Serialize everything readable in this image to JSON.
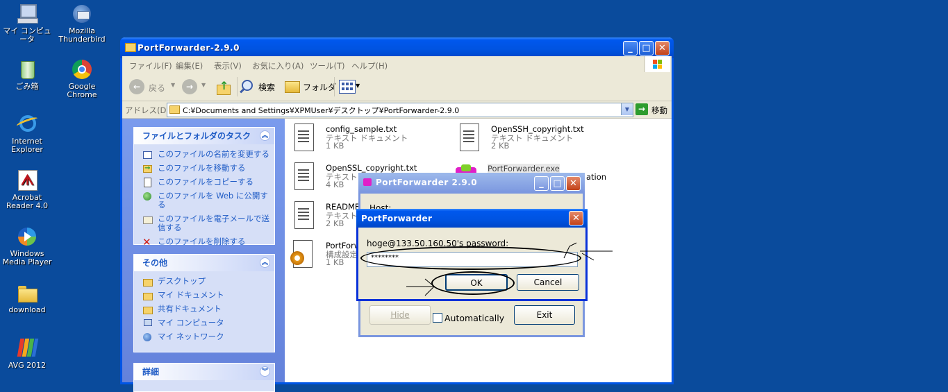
{
  "desktop": {
    "icons": [
      {
        "label": "マイ コンピュータ",
        "icon": "my-computer-icon"
      },
      {
        "label": "Mozilla Thunderbird",
        "icon": "thunderbird-icon"
      },
      {
        "label": "ごみ箱",
        "icon": "recycle-bin-icon"
      },
      {
        "label": "Google Chrome",
        "icon": "chrome-icon"
      },
      {
        "label": "Internet Explorer",
        "icon": "ie-icon"
      },
      {
        "label": "Acrobat Reader 4.0",
        "icon": "acrobat-icon"
      },
      {
        "label": "Windows Media Player",
        "icon": "wmp-icon"
      },
      {
        "label": "download",
        "icon": "folder-icon"
      },
      {
        "label": "AVG 2012",
        "icon": "avg-icon"
      }
    ]
  },
  "explorer": {
    "title": "PortForwarder-2.9.0",
    "menu": [
      "ファイル(F)",
      "編集(E)",
      "表示(V)",
      "お気に入り(A)",
      "ツール(T)",
      "ヘルプ(H)"
    ],
    "toolbar": {
      "back": "戻る",
      "search": "検索",
      "folders": "フォルダ"
    },
    "address": {
      "label": "アドレス(D)",
      "value": "C:¥Documents and Settings¥XPMUser¥デスクトップ¥PortForwarder-2.9.0",
      "go": "移動"
    },
    "tasks_panel": {
      "title": "ファイルとフォルダのタスク",
      "items": [
        "このファイルの名前を変更する",
        "このファイルを移動する",
        "このファイルをコピーする",
        "このファイルを Web に公開する",
        "このファイルを電子メールで送信する",
        "このファイルを削除する"
      ]
    },
    "other_panel": {
      "title": "その他",
      "items": [
        "デスクトップ",
        "マイ ドキュメント",
        "共有ドキュメント",
        "マイ コンピュータ",
        "マイ ネットワーク"
      ]
    },
    "details_panel": {
      "title": "詳細"
    },
    "files": [
      {
        "name": "config_sample.txt",
        "type": "テキスト ドキュメント",
        "size": "1 KB"
      },
      {
        "name": "OpenSSH_copyright.txt",
        "type": "テキスト ドキュメント",
        "size": "2 KB"
      },
      {
        "name": "OpenSSL_copyright.txt",
        "type": "テキスト ドキュ",
        "size": "4 KB"
      },
      {
        "name": "PortForwarder.exe",
        "type": "",
        "size": ""
      },
      {
        "name": "README.s",
        "type": "テキスト ド",
        "size": "2 KB"
      },
      {
        "name": "PortForwa",
        "type": "構成設定",
        "size": "1 KB"
      }
    ],
    "partial_text": "ation"
  },
  "pf_main": {
    "title": "PortForwarder 2.9.0",
    "host_label": "Host:",
    "hide_label": "Hide",
    "auto_label": "Automatically",
    "exit_label": "Exit"
  },
  "pw_dialog": {
    "title": "PortForwarder",
    "prompt": "hoge@133.50.160.50's password:",
    "password_mask": "********",
    "ok_label": "OK",
    "cancel_label": "Cancel"
  }
}
